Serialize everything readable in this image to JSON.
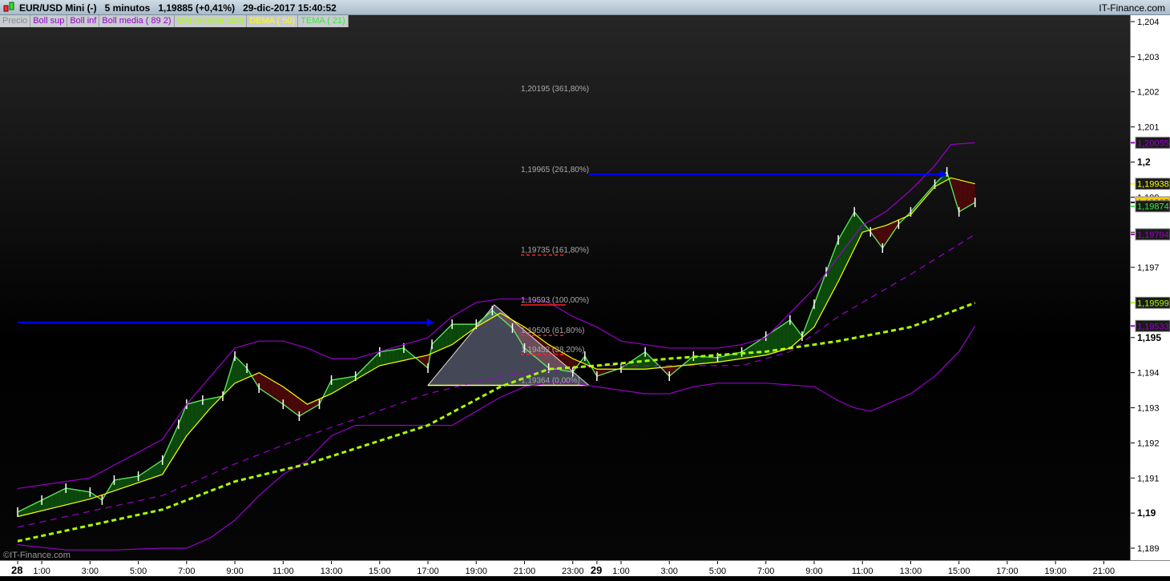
{
  "header": {
    "title": "EUR/USD Mini (-)   5 minutos   1,19885 (+0,41%)   29-dic-2017 15:40:52",
    "brand": "IT-Finance.com",
    "watermark": "©IT-Finance.com"
  },
  "legend": [
    {
      "label": "Precio",
      "color": "#8a8a8a"
    },
    {
      "label": "Boll sup",
      "color": "#9900cc"
    },
    {
      "label": "Boll inf",
      "color": "#9900cc"
    },
    {
      "label": "Boll media ( 89 2)",
      "color": "#9900cc"
    },
    {
      "label": "MM (Simple 200)",
      "color": "#aaff00"
    },
    {
      "label": "DEMA ( 50)",
      "color": "#ffff00"
    },
    {
      "label": "TEMA ( 21)",
      "color": "#33ee33"
    }
  ],
  "chart_data": {
    "type": "line",
    "symbol": "EUR/USD Mini",
    "interval": "5 minutos",
    "ylim": [
      1.189,
      1.204
    ],
    "yticks": [
      {
        "v": 1.204,
        "t": "1,204"
      },
      {
        "v": 1.203,
        "t": "1,203"
      },
      {
        "v": 1.202,
        "t": "1,202"
      },
      {
        "v": 1.201,
        "t": "1,201"
      },
      {
        "v": 1.2,
        "t": "1,2",
        "bold": true
      },
      {
        "v": 1.199,
        "t": "1,199"
      },
      {
        "v": 1.198,
        "t": "1,198"
      },
      {
        "v": 1.197,
        "t": "1,197"
      },
      {
        "v": 1.196,
        "t": "1,196"
      },
      {
        "v": 1.195,
        "t": "1,195",
        "bold": true
      },
      {
        "v": 1.194,
        "t": "1,194"
      },
      {
        "v": 1.193,
        "t": "1,193"
      },
      {
        "v": 1.192,
        "t": "1,192"
      },
      {
        "v": 1.191,
        "t": "1,191"
      },
      {
        "v": 1.19,
        "t": "1,19",
        "bold": true
      },
      {
        "v": 1.189,
        "t": "1,189"
      }
    ],
    "xticks": [
      {
        "x": "28 00:00",
        "t": "28",
        "bold": true
      },
      {
        "x": "28 01:00",
        "t": "1:00"
      },
      {
        "x": "28 03:00",
        "t": "3:00"
      },
      {
        "x": "28 05:00",
        "t": "5:00"
      },
      {
        "x": "28 07:00",
        "t": "7:00"
      },
      {
        "x": "28 09:00",
        "t": "9:00"
      },
      {
        "x": "28 11:00",
        "t": "11:00"
      },
      {
        "x": "28 13:00",
        "t": "13:00"
      },
      {
        "x": "28 15:00",
        "t": "15:00"
      },
      {
        "x": "28 17:00",
        "t": "17:00"
      },
      {
        "x": "28 19:00",
        "t": "19:00"
      },
      {
        "x": "28 21:00",
        "t": "21:00"
      },
      {
        "x": "28 23:00",
        "t": "23:00"
      },
      {
        "x": "29 00:00",
        "t": "29",
        "bold": true
      },
      {
        "x": "29 01:00",
        "t": "1:00"
      },
      {
        "x": "29 03:00",
        "t": "3:00"
      },
      {
        "x": "29 05:00",
        "t": "5:00"
      },
      {
        "x": "29 07:00",
        "t": "7:00"
      },
      {
        "x": "29 09:00",
        "t": "9:00"
      },
      {
        "x": "29 11:00",
        "t": "11:00"
      },
      {
        "x": "29 13:00",
        "t": "13:00"
      },
      {
        "x": "29 15:00",
        "t": "15:00"
      },
      {
        "x": "29 17:00",
        "t": "17:00"
      },
      {
        "x": "29 19:00",
        "t": "19:00"
      },
      {
        "x": "29 21:00",
        "t": "21:00"
      }
    ],
    "series": [
      {
        "name": "Precio",
        "color": "#ffffff",
        "points": [
          [
            "28 00:00",
            1.19003
          ],
          [
            "28 01:00",
            1.19037
          ],
          [
            "28 02:00",
            1.19071
          ],
          [
            "28 03:00",
            1.1906
          ],
          [
            "28 03:30",
            1.19037
          ],
          [
            "28 04:00",
            1.19094
          ],
          [
            "28 05:00",
            1.19105
          ],
          [
            "28 06:00",
            1.19151
          ],
          [
            "28 06:40",
            1.19253
          ],
          [
            "28 07:00",
            1.1931
          ],
          [
            "28 07:40",
            1.19322
          ],
          [
            "28 08:30",
            1.19333
          ],
          [
            "28 09:00",
            1.19447
          ],
          [
            "28 09:30",
            1.19413
          ],
          [
            "28 10:00",
            1.19356
          ],
          [
            "28 11:00",
            1.1931
          ],
          [
            "28 11:40",
            1.19276
          ],
          [
            "28 12:30",
            1.1931
          ],
          [
            "28 13:00",
            1.19379
          ],
          [
            "28 14:00",
            1.1939
          ],
          [
            "28 15:00",
            1.19459
          ],
          [
            "28 16:00",
            1.1947
          ],
          [
            "28 17:00",
            1.19413
          ],
          [
            "28 17:10",
            1.19481
          ],
          [
            "28 18:00",
            1.19538
          ],
          [
            "28 19:00",
            1.19538
          ],
          [
            "28 19:40",
            1.19577
          ],
          [
            "28 20:30",
            1.19527
          ],
          [
            "28 21:00",
            1.1947
          ],
          [
            "28 22:00",
            1.19413
          ],
          [
            "28 23:00",
            1.19402
          ],
          [
            "28 23:30",
            1.19447
          ],
          [
            "29 00:00",
            1.1939
          ],
          [
            "29 01:00",
            1.19413
          ],
          [
            "29 02:00",
            1.19459
          ],
          [
            "29 03:00",
            1.1939
          ],
          [
            "29 04:00",
            1.19447
          ],
          [
            "29 05:00",
            1.19443
          ],
          [
            "29 06:00",
            1.19459
          ],
          [
            "29 07:00",
            1.19504
          ],
          [
            "29 08:00",
            1.1955
          ],
          [
            "29 08:30",
            1.19504
          ],
          [
            "29 09:00",
            1.19595
          ],
          [
            "29 09:30",
            1.19687
          ],
          [
            "29 10:00",
            1.19778
          ],
          [
            "29 10:40",
            1.19858
          ],
          [
            "29 11:20",
            1.19801
          ],
          [
            "29 11:50",
            1.19755
          ],
          [
            "29 12:30",
            1.19823
          ],
          [
            "29 13:00",
            1.19858
          ],
          [
            "29 14:00",
            1.19937
          ],
          [
            "29 14:30",
            1.19972
          ],
          [
            "29 15:00",
            1.19858
          ],
          [
            "29 15:40",
            1.19885
          ]
        ]
      },
      {
        "name": "Boll sup",
        "color": "#9900cc",
        "points": [
          [
            "28 00:00",
            1.1907
          ],
          [
            "28 03:00",
            1.191
          ],
          [
            "28 06:00",
            1.1921
          ],
          [
            "28 07:00",
            1.1931
          ],
          [
            "28 08:00",
            1.1939
          ],
          [
            "28 09:00",
            1.1947
          ],
          [
            "28 10:00",
            1.1949
          ],
          [
            "28 11:00",
            1.1949
          ],
          [
            "28 12:00",
            1.1947
          ],
          [
            "28 13:00",
            1.1944
          ],
          [
            "28 14:00",
            1.1944
          ],
          [
            "28 15:00",
            1.1946
          ],
          [
            "28 16:00",
            1.1948
          ],
          [
            "28 17:00",
            1.195
          ],
          [
            "28 18:00",
            1.1956
          ],
          [
            "28 19:00",
            1.196
          ],
          [
            "28 20:00",
            1.1961
          ],
          [
            "28 21:00",
            1.1961
          ],
          [
            "28 22:00",
            1.196
          ],
          [
            "28 23:00",
            1.1956
          ],
          [
            "29 00:00",
            1.1953
          ],
          [
            "29 01:00",
            1.1949
          ],
          [
            "29 02:00",
            1.1948
          ],
          [
            "29 03:00",
            1.1947
          ],
          [
            "29 05:00",
            1.1947
          ],
          [
            "29 06:00",
            1.1948
          ],
          [
            "29 07:00",
            1.195
          ],
          [
            "29 08:00",
            1.1957
          ],
          [
            "29 09:00",
            1.1964
          ],
          [
            "29 10:00",
            1.1973
          ],
          [
            "29 11:00",
            1.1982
          ],
          [
            "29 12:00",
            1.1986
          ],
          [
            "29 13:00",
            1.1992
          ],
          [
            "29 14:00",
            1.1999
          ],
          [
            "29 14:40",
            1.2005
          ],
          [
            "29 15:40",
            1.20055
          ]
        ]
      },
      {
        "name": "Boll inf",
        "color": "#9900cc",
        "points": [
          [
            "28 00:00",
            1.1891
          ],
          [
            "28 02:00",
            1.18895
          ],
          [
            "28 04:00",
            1.18895
          ],
          [
            "28 06:00",
            1.189
          ],
          [
            "28 07:00",
            1.189
          ],
          [
            "28 08:00",
            1.1893
          ],
          [
            "28 09:00",
            1.1898
          ],
          [
            "28 10:00",
            1.1905
          ],
          [
            "28 11:00",
            1.1911
          ],
          [
            "28 12:00",
            1.1915
          ],
          [
            "28 13:00",
            1.1922
          ],
          [
            "28 14:00",
            1.1925
          ],
          [
            "28 15:00",
            1.1925
          ],
          [
            "28 16:00",
            1.1925
          ],
          [
            "28 17:00",
            1.1925
          ],
          [
            "28 18:00",
            1.1925
          ],
          [
            "28 19:00",
            1.1929
          ],
          [
            "28 20:00",
            1.1933
          ],
          [
            "28 21:00",
            1.1936
          ],
          [
            "28 22:00",
            1.1937
          ],
          [
            "28 23:00",
            1.1937
          ],
          [
            "29 00:00",
            1.1936
          ],
          [
            "29 02:00",
            1.1934
          ],
          [
            "29 03:00",
            1.1934
          ],
          [
            "29 04:00",
            1.1936
          ],
          [
            "29 05:00",
            1.1937
          ],
          [
            "29 07:00",
            1.1937
          ],
          [
            "29 09:00",
            1.1936
          ],
          [
            "29 10:00",
            1.1932
          ],
          [
            "29 10:40",
            1.193
          ],
          [
            "29 11:20",
            1.1929
          ],
          [
            "29 12:00",
            1.1931
          ],
          [
            "29 13:00",
            1.1934
          ],
          [
            "29 14:00",
            1.1939
          ],
          [
            "29 15:00",
            1.1946
          ],
          [
            "29 15:40",
            1.19533
          ]
        ]
      },
      {
        "name": "Boll media ( 89 2)",
        "color": "#9900cc",
        "dashed": true,
        "points": [
          [
            "28 00:00",
            1.1896
          ],
          [
            "28 06:00",
            1.1905
          ],
          [
            "28 09:00",
            1.1914
          ],
          [
            "28 12:00",
            1.1922
          ],
          [
            "28 17:00",
            1.1934
          ],
          [
            "28 20:00",
            1.1939
          ],
          [
            "29 00:00",
            1.1942
          ],
          [
            "29 06:00",
            1.1942
          ],
          [
            "29 08:00",
            1.1946
          ],
          [
            "29 10:00",
            1.1956
          ],
          [
            "29 13:00",
            1.1968
          ],
          [
            "29 15:40",
            1.19794
          ]
        ]
      },
      {
        "name": "MM (Simple 200)",
        "color": "#aaff00",
        "dashed": true,
        "thick": true,
        "points": [
          [
            "28 00:00",
            1.1892
          ],
          [
            "28 06:00",
            1.1901
          ],
          [
            "28 09:00",
            1.1909
          ],
          [
            "28 12:00",
            1.1914
          ],
          [
            "28 17:00",
            1.1925
          ],
          [
            "28 20:00",
            1.1936
          ],
          [
            "28 22:00",
            1.1941
          ],
          [
            "29 00:00",
            1.1942
          ],
          [
            "29 03:00",
            1.1944
          ],
          [
            "29 07:00",
            1.1946
          ],
          [
            "29 10:00",
            1.1949
          ],
          [
            "29 13:00",
            1.1953
          ],
          [
            "29 15:40",
            1.19599
          ]
        ]
      },
      {
        "name": "DEMA ( 50)",
        "color": "#ffff00",
        "points": [
          [
            "28 00:00",
            1.1899
          ],
          [
            "28 03:00",
            1.1904
          ],
          [
            "28 06:00",
            1.1911
          ],
          [
            "28 07:00",
            1.1922
          ],
          [
            "28 08:00",
            1.193
          ],
          [
            "28 09:00",
            1.1937
          ],
          [
            "28 10:00",
            1.194
          ],
          [
            "28 11:00",
            1.1936
          ],
          [
            "28 12:00",
            1.1931
          ],
          [
            "28 13:00",
            1.1934
          ],
          [
            "28 15:00",
            1.1942
          ],
          [
            "28 17:00",
            1.1945
          ],
          [
            "28 18:00",
            1.1948
          ],
          [
            "28 19:00",
            1.1953
          ],
          [
            "28 20:00",
            1.1957
          ],
          [
            "28 21:00",
            1.1953
          ],
          [
            "28 22:00",
            1.1948
          ],
          [
            "28 23:00",
            1.1944
          ],
          [
            "29 00:00",
            1.1941
          ],
          [
            "29 02:00",
            1.1941
          ],
          [
            "29 05:00",
            1.1943
          ],
          [
            "29 07:00",
            1.1945
          ],
          [
            "29 08:00",
            1.1947
          ],
          [
            "29 09:00",
            1.1953
          ],
          [
            "29 10:00",
            1.1966
          ],
          [
            "29 11:00",
            1.198
          ],
          [
            "29 12:00",
            1.1982
          ],
          [
            "29 13:00",
            1.1985
          ],
          [
            "29 14:00",
            1.1993
          ],
          [
            "29 14:40",
            1.19955
          ],
          [
            "29 15:40",
            1.19938
          ]
        ]
      }
    ],
    "fill_colors": {
      "above": "#0c4a0c",
      "below": "#4a0808"
    },
    "fibonacci": {
      "levels": [
        {
          "v": 1.20195,
          "t": "1,20195 (361,80%)"
        },
        {
          "v": 1.19965,
          "t": "1,19965 (261,80%)"
        },
        {
          "v": 1.19735,
          "t": "1,19735 (161,80%)",
          "mark": "dashed"
        },
        {
          "v": 1.19593,
          "t": "1,19593 (100,00%)",
          "mark": "solid"
        },
        {
          "v": 1.19506,
          "t": "1,19506 (61,80%)",
          "mark": "dashed"
        },
        {
          "v": 1.19452,
          "t": "1,19452 (38,20%)",
          "mark": "dashed"
        },
        {
          "v": 1.19364,
          "t": "1,19364 (0,00%)"
        }
      ],
      "triangle": [
        [
          "28 17:00",
          1.19364
        ],
        [
          "28 19:45",
          1.19593
        ],
        [
          "28 23:40",
          1.19364
        ]
      ]
    },
    "arrows": [
      {
        "from": [
          "28 00:00",
          1.19543
        ],
        "to": [
          "28 17:15",
          1.19543
        ],
        "color": "#0000ff"
      },
      {
        "from": [
          "28 23:40",
          1.19965
        ],
        "to": [
          "29 14:30",
          1.19965
        ],
        "color": "#0000ff"
      }
    ],
    "price_tags": [
      {
        "v": 1.20055,
        "t": "1,20055",
        "color": "#9900cc",
        "bg": "#1a1a1a"
      },
      {
        "v": 1.19938,
        "t": "1,19938",
        "color": "#ffff00",
        "bg": "#1a1a1a"
      },
      {
        "v": 1.19885,
        "t": "1,19885",
        "color": "#000000",
        "bg": "#ffcc00"
      },
      {
        "v": 1.19874,
        "t": "1,19874",
        "color": "#33ee33",
        "bg": "#1a1a1a"
      },
      {
        "v": 1.19794,
        "t": "1,19794",
        "color": "#9900cc",
        "bg": "#1a1a1a"
      },
      {
        "v": 1.19599,
        "t": "1,19599",
        "color": "#aaff00",
        "bg": "#1a1a1a"
      },
      {
        "v": 1.19533,
        "t": "1,19533",
        "color": "#9900cc",
        "bg": "#1a1a1a"
      }
    ]
  }
}
